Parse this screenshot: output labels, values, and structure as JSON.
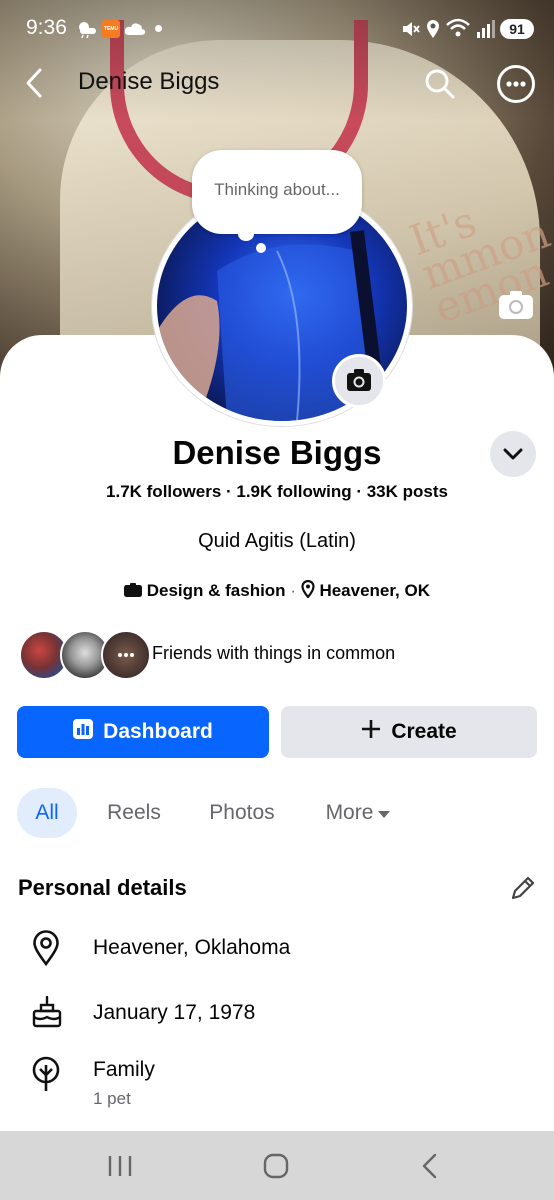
{
  "status_bar": {
    "time": "9:36",
    "temu_label": "TEMU",
    "battery": "91"
  },
  "header": {
    "title": "Denise Biggs"
  },
  "profile": {
    "thought_placeholder": "Thinking about...",
    "name": "Denise Biggs",
    "stats": "1.7K followers · 1.9K following · 33K posts",
    "bio": "Quid Agitis (Latin)",
    "category": "Design & fashion",
    "location": "Heavener, OK",
    "friends_text": "Friends with things in common"
  },
  "actions": {
    "dashboard": "Dashboard",
    "create": "Create"
  },
  "tabs": {
    "all": "All",
    "reels": "Reels",
    "photos": "Photos",
    "more": "More"
  },
  "personal_details": {
    "title": "Personal details",
    "location": "Heavener, Oklahoma",
    "birthday": "January 17, 1978",
    "family": "Family",
    "family_sub": "1 pet"
  },
  "colors": {
    "accent": "#0866ff",
    "secondary_btn": "#e4e6eb",
    "muted_text": "#65676b",
    "tab_active_bg": "#e1edfd"
  }
}
